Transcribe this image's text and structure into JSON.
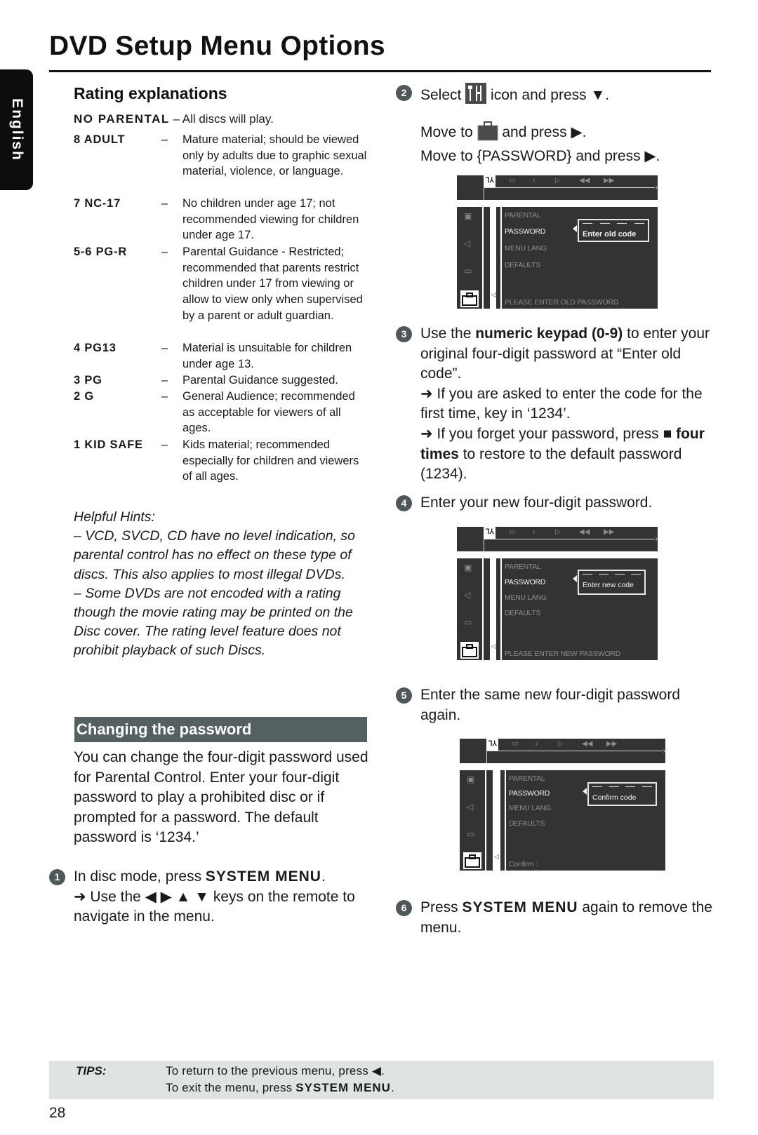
{
  "page": {
    "title": "DVD Setup Menu Options",
    "language_tab": "English",
    "page_number": "28"
  },
  "ratings": {
    "heading": "Rating explanations",
    "no_parental": {
      "label": "NO PARENTAL",
      "desc": "– All discs will play."
    },
    "items": [
      {
        "label": "8 ADULT",
        "dash": "–",
        "desc": "Mature material; should be viewed  only by adults due to graphic sexual material, violence, or language."
      },
      {
        "label": "7 NC-17",
        "dash": "–",
        "desc": "No children under age 17; not recommended viewing for children under age 17."
      },
      {
        "label": "5-6 PG-R",
        "dash": "–",
        "desc": "Parental Guidance - Restricted; recommended that parents restrict children under 17 from viewing or allow to view only when supervised by a parent or adult guardian."
      },
      {
        "label": "4 PG13",
        "dash": "–",
        "desc": "Material is unsuitable for children under age 13."
      },
      {
        "label": "3 PG",
        "dash": "–",
        "desc": "Parental Guidance suggested."
      },
      {
        "label": "2 G",
        "dash": "–",
        "desc": "General Audience; recommended as acceptable for viewers of all ages."
      },
      {
        "label": "1 KID SAFE",
        "dash": "–",
        "desc": "Kids material; recommended especially for children and viewers of all ages."
      }
    ]
  },
  "hints": {
    "heading": "Helpful Hints:",
    "items": [
      "–  VCD, SVCD, CD have no level indication, so parental control has no effect on these type of discs. This also applies to most illegal DVDs.",
      "–  Some DVDs are not encoded with a rating though the movie rating may be printed on the Disc cover. The rating level feature does not prohibit playback of such Discs."
    ]
  },
  "change_password": {
    "heading": "Changing the password",
    "body": "You can change the four-digit password used for Parental Control.  Enter your four-digit password to play a prohibited disc or if prompted for a password. The default password is ‘1234.’"
  },
  "steps": {
    "s1": {
      "num": "1",
      "pre": "In disc mode, press ",
      "bold": "SYSTEM MENU",
      "post": ".",
      "sub_pre": "➜ Use the ",
      "keys": "◀ ▶ ▲ ▼",
      "sub_post": " keys on the remote to navigate in the menu."
    },
    "s2": {
      "num": "2",
      "l1_pre": "Select ",
      "l1_post": " icon and press ▼.",
      "l2_pre": "Move to ",
      "l2_post": " and press ▶.",
      "l3": "Move to {PASSWORD} and press ▶."
    },
    "s3": {
      "num": "3",
      "pre": "Use the ",
      "bold": "numeric keypad (0-9)",
      "post": " to enter your original four-digit password at “Enter old code”.",
      "sub1": "➜ If you are asked to enter the code for the first time, key in ‘1234’.",
      "sub2_pre": "➜ If you forget your password, press ",
      "sub2_key": "■",
      "sub2_bold": "four times",
      "sub2_post": " to restore to the default password (1234)."
    },
    "s4": {
      "num": "4",
      "text": "Enter your new four-digit password."
    },
    "s5": {
      "num": "5",
      "text": "Enter the same new four-digit password again."
    },
    "s6": {
      "num": "6",
      "pre": "Press ",
      "bold": "SYSTEM MENU",
      "post": " again to remove the menu."
    }
  },
  "osd_screens": [
    {
      "menu": [
        "PARENTAL",
        "PASSWORD",
        "MENU LANG",
        "DEFAULTS"
      ],
      "active": "PASSWORD",
      "code_label": "Enter old code",
      "prompt": "PLEASE ENTER OLD PASSWORD"
    },
    {
      "menu": [
        "PARENTAL",
        "PASSWORD",
        "MENU LANG",
        "DEFAULTS"
      ],
      "active": "PASSWORD",
      "code_label": "Enter new code",
      "prompt": "PLEASE ENTER NEW PASSWORD"
    },
    {
      "menu": [
        "PARENTAL",
        "PASSWORD",
        "MENU LANG",
        "DEFAULTS"
      ],
      "active": "PASSWORD",
      "code_label": "Confirm code",
      "prompt": "Confirm :"
    }
  ],
  "osd_top_icons": [
    "setup-icon",
    "subtitle-icon",
    "audio-icon",
    "play-icon",
    "rewind-icon",
    "fast-forward-icon"
  ],
  "osd_side_icons": [
    "picture-icon",
    "speaker-icon",
    "subtitle-bubble-icon",
    "briefcase-icon"
  ],
  "tips": {
    "label": "TIPS:",
    "line1": "To return to the previous menu, press ◀.",
    "line2_pre": "To exit the menu, press ",
    "line2_bold": "SYSTEM MENU",
    "line2_post": "."
  }
}
